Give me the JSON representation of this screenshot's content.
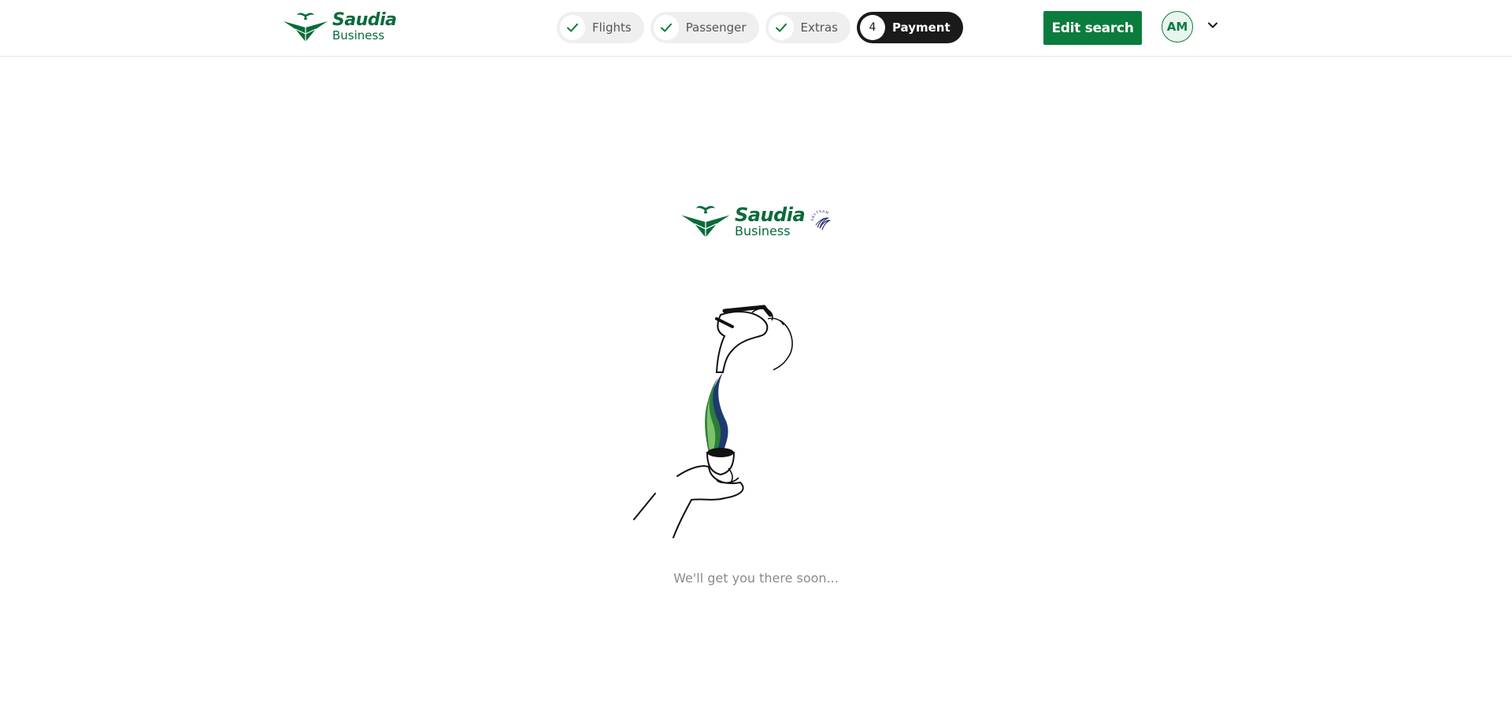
{
  "header": {
    "brand": {
      "name": "Saudia",
      "sub": "Business"
    },
    "steps": [
      {
        "label": "Flights",
        "state": "done",
        "icon": "check-icon"
      },
      {
        "label": "Passenger",
        "state": "done",
        "icon": "check-icon"
      },
      {
        "label": "Extras",
        "state": "done",
        "icon": "check-icon"
      },
      {
        "label": "Payment",
        "state": "active",
        "number": "4"
      }
    ],
    "edit_search_label": "Edit search",
    "avatar_initials": "AM",
    "avatar_menu_icon": "chevron-down-icon"
  },
  "main": {
    "logo": {
      "name": "Saudia",
      "sub": "Business",
      "alliance": "SKYTEAM"
    },
    "loading_text": "We'll get you there soon..."
  },
  "colors": {
    "brand_green": "#0a7c3e",
    "dark_green": "#0a6b3a",
    "active_step": "#1a1a1a",
    "muted_text": "#8a8a8a"
  }
}
